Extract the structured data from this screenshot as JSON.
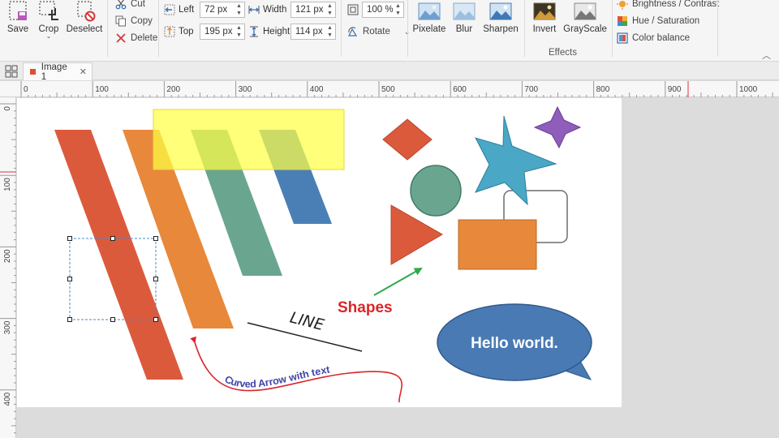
{
  "ribbon": {
    "file": {
      "save": "Save",
      "crop": "Crop",
      "deselect": "Deselect"
    },
    "clipboard": {
      "cut": "Cut",
      "copy": "Copy",
      "delete": "Delete"
    },
    "position": {
      "left_label": "Left",
      "left_value": "72 px",
      "top_label": "Top",
      "top_value": "195 px",
      "width_label": "Width",
      "width_value": "121 px",
      "height_label": "Height",
      "height_value": "114 px"
    },
    "transform": {
      "zoom_value": "100 %",
      "rotate_label": "Rotate"
    },
    "effects": {
      "title": "Effects",
      "pixelate": "Pixelate",
      "blur": "Blur",
      "sharpen": "Sharpen",
      "invert": "Invert",
      "grayscale": "GrayScale",
      "brightness": "Brightness / Contrast",
      "hue": "Hue / Saturation",
      "color_balance": "Color balance"
    }
  },
  "tabs": [
    {
      "label": "Image 1",
      "active": true,
      "close_icon": "close-icon"
    }
  ],
  "rulers": {
    "horizontal": [
      "0",
      "100",
      "200",
      "300",
      "400",
      "500",
      "600",
      "700",
      "800",
      "900",
      "1000"
    ],
    "vertical": [
      "0",
      "100",
      "200",
      "300",
      "400"
    ]
  },
  "canvas": {
    "shapes_label": "Shapes",
    "line_label": "LINE",
    "curved_arrow_text": "Curved Arrow with text",
    "callout_text": "Hello world."
  },
  "colors": {
    "accent_red": "#d9262a",
    "stripe_red": "#dc5a3c",
    "stripe_orange": "#e8883a",
    "stripe_teal": "#6aa68f",
    "stripe_blue": "#4a7fb6",
    "highlight_yellow": "#ffff45",
    "star_blue": "#4aa7c6",
    "star_purple": "#8f5dbb",
    "callout_blue": "#4a7ab3",
    "arrow_green": "#2eaa4a"
  }
}
